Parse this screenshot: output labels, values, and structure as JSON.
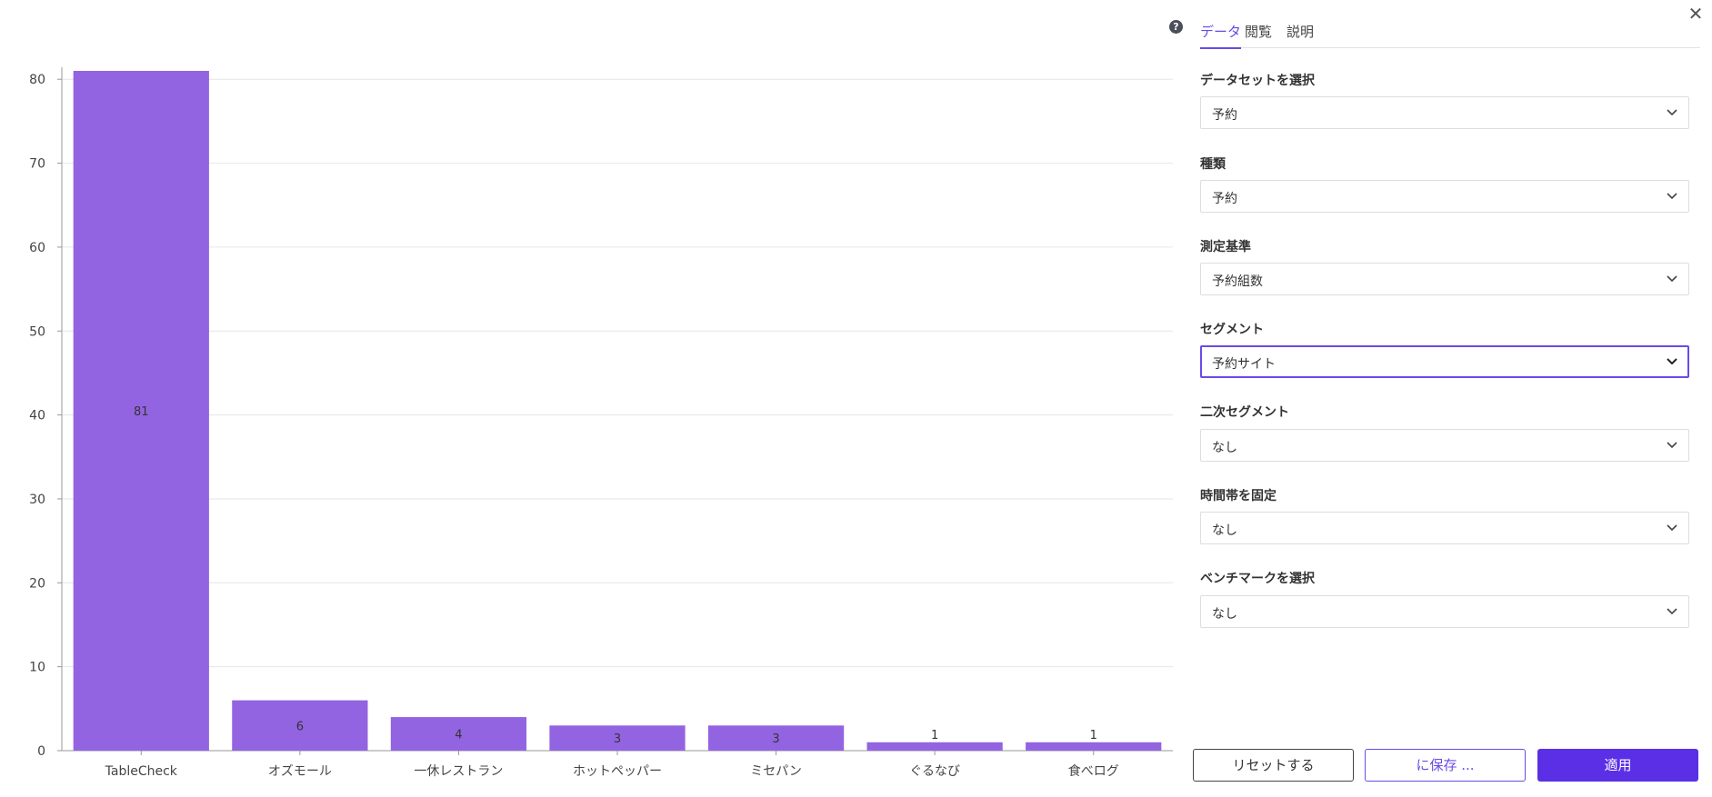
{
  "chart_data": {
    "type": "bar",
    "categories": [
      "TableCheck",
      "オズモール",
      "一休レストラン",
      "ホットペッパー",
      "ミセパン",
      "ぐるなび",
      "食べログ"
    ],
    "values": [
      81,
      6,
      4,
      3,
      3,
      1,
      1
    ],
    "value_labels": [
      "81",
      "6",
      "4",
      "3",
      "3",
      "1",
      "1"
    ],
    "yticks": [
      0,
      10,
      20,
      30,
      40,
      50,
      60,
      70,
      80
    ],
    "ylim": [
      0,
      81
    ],
    "grid": true,
    "bar_color": "#9364e1"
  },
  "panel": {
    "tabs": [
      {
        "label": "データ",
        "active": true
      },
      {
        "label": "閲覧",
        "active": false
      },
      {
        "label": "説明",
        "active": false
      }
    ],
    "help_icon": "question-circle-icon",
    "close_icon": "close-icon",
    "fields": [
      {
        "label": "データセットを選択",
        "value": "予約"
      },
      {
        "label": "種類",
        "value": "予約"
      },
      {
        "label": "測定基準",
        "value": "予約組数"
      },
      {
        "label": "セグメント",
        "value": "予約サイト"
      },
      {
        "label": "二次セグメント",
        "value": "なし"
      },
      {
        "label": "時間帯を固定",
        "value": "なし"
      },
      {
        "label": "ベンチマークを選択",
        "value": "なし"
      }
    ],
    "buttons": {
      "reset": "リセットする",
      "save": "に保存 ...",
      "apply": "適用"
    },
    "accent_color": "#6a4ae8"
  }
}
